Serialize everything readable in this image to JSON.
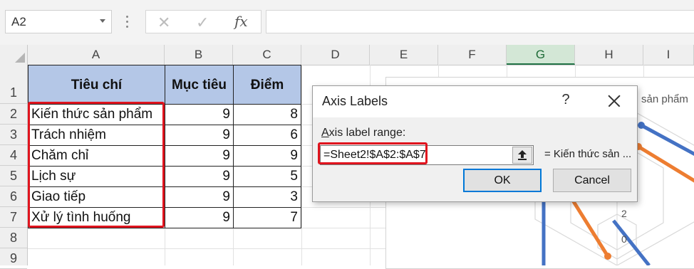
{
  "name_box": {
    "value": "A2"
  },
  "formula_bar": {
    "cancel_glyph": "✕",
    "enter_glyph": "✓",
    "fx_label": "fx",
    "value": ""
  },
  "columns": [
    "A",
    "B",
    "C",
    "D",
    "E",
    "F",
    "G",
    "H",
    "I"
  ],
  "selected_column": "G",
  "rows": [
    "1",
    "2",
    "3",
    "4",
    "5",
    "6",
    "7",
    "8",
    "9"
  ],
  "table": {
    "headers": [
      "Tiêu chí",
      "Mục tiêu",
      "Điểm"
    ],
    "rows": [
      {
        "criterion": "Kiến thức sản phẩm",
        "target": "9",
        "score": "8"
      },
      {
        "criterion": "Trách nhiệm",
        "target": "9",
        "score": "6"
      },
      {
        "criterion": "Chăm chỉ",
        "target": "9",
        "score": "9"
      },
      {
        "criterion": "Lịch sự",
        "target": "9",
        "score": "5"
      },
      {
        "criterion": "Giao tiếp",
        "target": "9",
        "score": "3"
      },
      {
        "criterion": "Xử lý tình huống",
        "target": "9",
        "score": "7"
      }
    ]
  },
  "chart": {
    "visible_label": "sản phẩm",
    "tick_labels": [
      "2",
      "0"
    ],
    "colors": {
      "series_blue": "#4472c4",
      "series_orange": "#ed7d31"
    }
  },
  "dialog": {
    "title": "Axis Labels",
    "help": "?",
    "field_label_accel": "A",
    "field_label_rest": "xis label range:",
    "range_value": "=Sheet2!$A$2:$A$7",
    "range_preview": "= Kiến thức sản ...",
    "ok_label": "OK",
    "cancel_label": "Cancel"
  },
  "highlight_color": "#e0141e",
  "header_fill_color": "#b4c7e7"
}
